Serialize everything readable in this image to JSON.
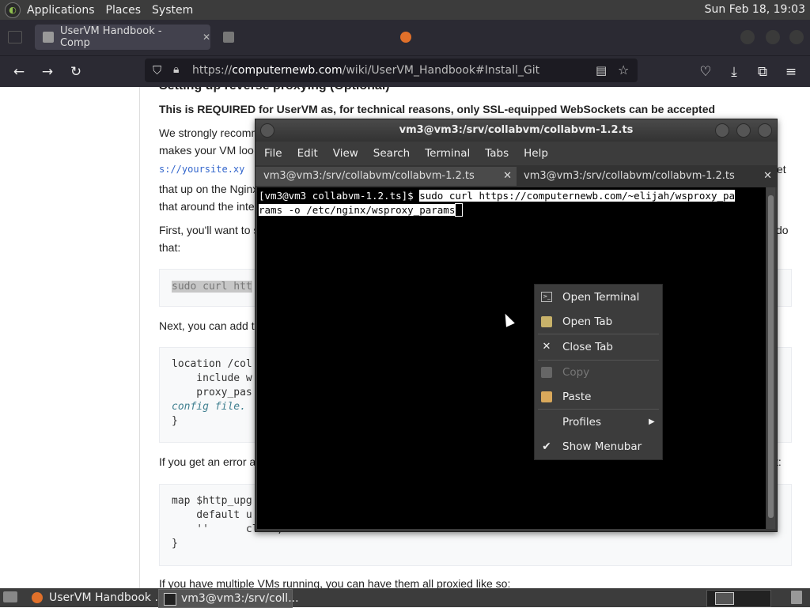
{
  "top_panel": {
    "menus": [
      "Applications",
      "Places",
      "System"
    ],
    "clock": "Sun Feb 18, 19:03"
  },
  "browser": {
    "tabs": [
      {
        "title": "UserVM Handbook - Comp",
        "state": "active"
      },
      {
        "title": "",
        "state": "faded"
      },
      {
        "title": "",
        "state": "faded"
      }
    ],
    "url_prefix": "https://",
    "url_domain": "computernewb.com",
    "url_path": "/wiki/UserVM_Handbook#Install_Git"
  },
  "page": {
    "partial_heading": "Setting up reverse proxying (Optional)",
    "bold_line": "This is REQUIRED for UserVM as, for technical reasons, only SSL-equipped WebSockets can be accepted",
    "p1_start": "We strongly recomm",
    "p1_line2": "makes your VM loo",
    "p1_line3_code": "s://yoursite.xy",
    "p1_line3_end": "et",
    "p1_line4": "that up on the Nginx",
    "p1_line5": "that around the inte",
    "p2_start": "First, you'll want to s",
    "p2_end": "do",
    "p2_line2": "that:",
    "code1": "sudo curl htt",
    "p3": "Next, you can add t",
    "code2_lines": [
      "location /col",
      "    include w",
      "    proxy_pas"
    ],
    "code2_comment": "config file.",
    "code2_close": "}",
    "p4_start": "If you get an error a",
    "p4_end": "t:",
    "code3_lines": [
      "map $http_upg",
      "    default u",
      "    ''      close;"
    ],
    "code3_close": "}",
    "p5": "If you have multiple VMs running, you can have them all proxied like so:"
  },
  "terminal": {
    "title": "vm3@vm3:/srv/collabvm/collabvm-1.2.ts",
    "menu": [
      "File",
      "Edit",
      "View",
      "Search",
      "Terminal",
      "Tabs",
      "Help"
    ],
    "tabs": [
      {
        "label": "vm3@vm3:/srv/collabvm/collabvm-1.2.ts",
        "active": true
      },
      {
        "label": "vm3@vm3:/srv/collabvm/collabvm-1.2.ts",
        "active": false
      }
    ],
    "prompt": "[vm3@vm3 collabvm-1.2.ts]$",
    "command_line1": "sudo curl https://computernewb.com/~elijah/wsproxy_pa",
    "command_line2": "rams -o /etc/nginx/wsproxy_params"
  },
  "context_menu": {
    "items": [
      {
        "label": "Open Terminal",
        "icon": "terminal-icon",
        "enabled": true
      },
      {
        "label": "Open Tab",
        "icon": "new-tab-icon",
        "enabled": true
      },
      {
        "label": "Close Tab",
        "icon": "close-icon",
        "enabled": true
      },
      {
        "label": "Copy",
        "icon": "copy-icon",
        "enabled": false
      },
      {
        "label": "Paste",
        "icon": "paste-icon",
        "enabled": true
      },
      {
        "label": "Profiles",
        "icon": "submenu-arrow-icon",
        "enabled": true
      },
      {
        "label": "Show Menubar",
        "icon": "checkmark-icon",
        "enabled": true
      }
    ]
  },
  "taskbar": {
    "tasks": [
      {
        "label": "UserVM Handbook ...",
        "icon": "firefox-icon",
        "active": false
      },
      {
        "label": "vm3@vm3:/srv/coll...",
        "icon": "terminal-icon",
        "active": true
      }
    ]
  },
  "colors": {
    "panel_bg": "#3c3c3c",
    "browser_chrome": "#2b2a33",
    "terminal_bg": "#000000",
    "link_code": "#3366cc"
  }
}
